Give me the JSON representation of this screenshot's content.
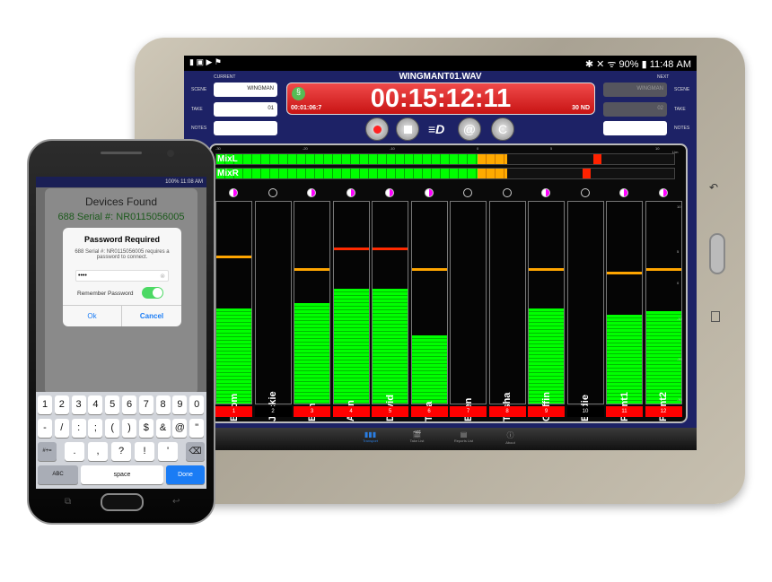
{
  "tablet": {
    "status": {
      "left_icons": [
        "person-icon",
        "image-icon",
        "play-icon",
        "flag-icon"
      ],
      "right": "90%",
      "time": "11:48 AM"
    },
    "filename": "WINGMANT01.WAV",
    "current": {
      "header": "CURRENT",
      "scene_label": "SCENE",
      "scene": "WINGMAN",
      "take_label": "TAKE",
      "take": "01",
      "notes_label": "NOTES",
      "notes": ""
    },
    "next": {
      "header": "NEXT",
      "scene_label": "SCENE",
      "scene": "WINGMAN",
      "take_label": "TAKE",
      "take": "02",
      "notes_label": "NOTES",
      "notes": ""
    },
    "timer": {
      "timecode": "00:15:12:11",
      "elapsed": "00:01:06:7",
      "rate": "30 ND"
    },
    "meter_scale": [
      "-30",
      "-20",
      "-10",
      "0",
      "5",
      "10"
    ],
    "meter_scale_unit": "Lim",
    "side_scale": [
      "10",
      "5",
      "0",
      "-10",
      "-20",
      "-30"
    ],
    "mix_meters": [
      {
        "name": "MixL",
        "green_db": 0,
        "orange_db": 2,
        "peak_db": 7
      },
      {
        "name": "MixR",
        "green_db": 0,
        "orange_db": 2,
        "peak_db": 6.5
      }
    ],
    "channels": [
      {
        "name": "Boom",
        "num": "1",
        "level": 47,
        "peak": 72,
        "peak_color": "#ffa500",
        "armed": true
      },
      {
        "name": "Jackie",
        "num": "2",
        "level": 0,
        "peak": null,
        "armed": false
      },
      {
        "name": "Ben",
        "num": "3",
        "level": 50,
        "peak": 66,
        "peak_color": "#ffa500",
        "armed": true
      },
      {
        "name": "Alan",
        "num": "4",
        "level": 57,
        "peak": 76,
        "peak_color": "#ff2a00",
        "armed": true
      },
      {
        "name": "David",
        "num": "5",
        "level": 57,
        "peak": 76,
        "peak_color": "#ff2a00",
        "armed": true
      },
      {
        "name": "Tina",
        "num": "6",
        "level": 34,
        "peak": 66,
        "peak_color": "#ffa500",
        "armed": true
      },
      {
        "name": "Ellen",
        "num": "7",
        "level": 0,
        "peak": null,
        "armed": true
      },
      {
        "name": "Trisha",
        "num": "8",
        "level": 0,
        "peak": null,
        "armed": true
      },
      {
        "name": "Griffin",
        "num": "9",
        "level": 47,
        "peak": 66,
        "peak_color": "#ffa500",
        "armed": true
      },
      {
        "name": "Eddie",
        "num": "10",
        "level": 0,
        "peak": null,
        "armed": false
      },
      {
        "name": "Plant1",
        "num": "11",
        "level": 44,
        "peak": 64,
        "peak_color": "#ffa500",
        "armed": true
      },
      {
        "name": "Plant2",
        "num": "12",
        "level": 46,
        "peak": 66,
        "peak_color": "#ffa500",
        "armed": true
      }
    ],
    "tabs": [
      {
        "label": "Transport",
        "icon": "bars-icon",
        "active": true
      },
      {
        "label": "Take List",
        "icon": "clapper-icon"
      },
      {
        "label": "Reports List",
        "icon": "document-icon"
      },
      {
        "label": "About",
        "icon": "info-icon"
      }
    ]
  },
  "phone": {
    "status": {
      "right": "100%",
      "time": "11:08 AM"
    },
    "devices_title": "Devices Found",
    "device": "688 Serial #: NR0115056005",
    "dialog": {
      "title": "Password Required",
      "message": "688 Serial #: NR0115056005 requires a password to connect.",
      "password": "••••",
      "remember_label": "Remember Password",
      "remember": true,
      "ok": "Ok",
      "cancel": "Cancel"
    },
    "keyboard": {
      "row1": [
        "1",
        "2",
        "3",
        "4",
        "5",
        "6",
        "7",
        "8",
        "9",
        "0"
      ],
      "row2": [
        "-",
        "/",
        ":",
        ";",
        "(",
        ")",
        "$",
        "&",
        "@",
        "\""
      ],
      "row3_mode": "#+=",
      "row3": [
        ".",
        ",",
        "?",
        "!",
        "'"
      ],
      "abc": "ABC",
      "space": "space",
      "done": "Done"
    }
  }
}
